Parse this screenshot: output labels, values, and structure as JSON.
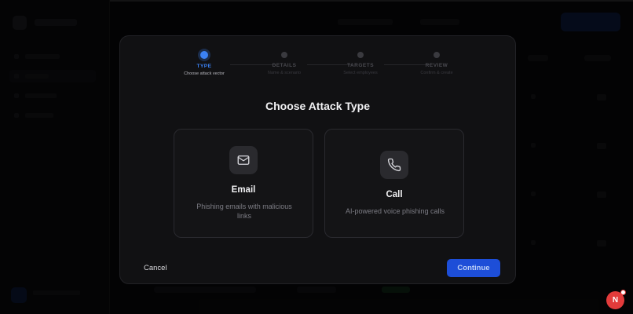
{
  "stepper": {
    "steps": [
      {
        "label": "TYPE",
        "sub": "Choose attack vector",
        "active": true
      },
      {
        "label": "DETAILS",
        "sub": "Name & scenario",
        "active": false
      },
      {
        "label": "TARGETS",
        "sub": "Select employees",
        "active": false
      },
      {
        "label": "REVIEW",
        "sub": "Confirm & create",
        "active": false
      }
    ]
  },
  "modal": {
    "title": "Choose Attack Type",
    "options": [
      {
        "icon": "mail-icon",
        "title": "Email",
        "description": "Phishing emails with malicious links"
      },
      {
        "icon": "phone-icon",
        "title": "Call",
        "description": "AI-powered voice phishing calls"
      }
    ],
    "cancel_label": "Cancel",
    "continue_label": "Continue"
  },
  "fab": {
    "label": "N"
  },
  "colors": {
    "accent": "#3b82f6",
    "primary_button": "#1d4ed8",
    "fab": "#e23b3b"
  }
}
